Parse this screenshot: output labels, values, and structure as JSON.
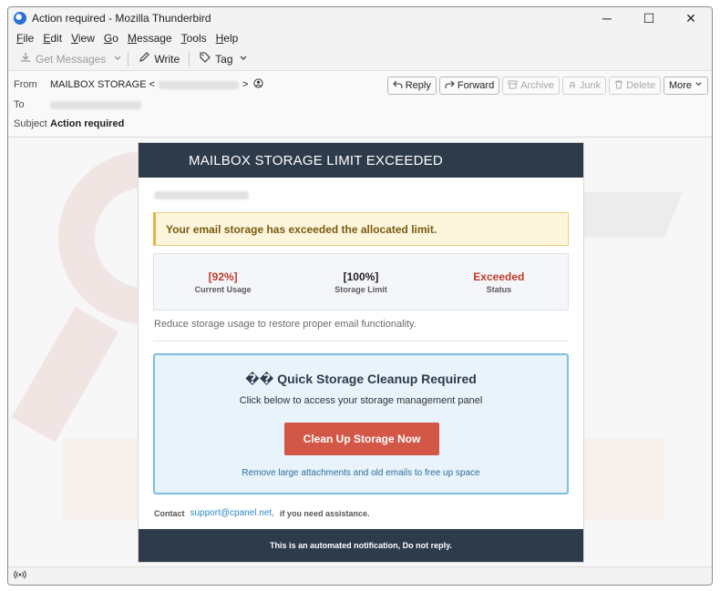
{
  "window": {
    "title": "Action required - Mozilla Thunderbird",
    "minimize": "─",
    "maximize": "☐",
    "close": "✕"
  },
  "menubar": {
    "items": [
      {
        "u": "F",
        "rest": "ile"
      },
      {
        "u": "E",
        "rest": "dit"
      },
      {
        "u": "V",
        "rest": "iew"
      },
      {
        "u": "G",
        "rest": "o"
      },
      {
        "u": "M",
        "rest": "essage"
      },
      {
        "u": "T",
        "rest": "ools"
      },
      {
        "u": "H",
        "rest": "elp"
      }
    ]
  },
  "toolbar": {
    "get_messages": "Get Messages",
    "write": "Write",
    "tag": "Tag"
  },
  "header": {
    "from_label": "From",
    "from_value": "MAILBOX STORAGE <",
    "from_close": ">",
    "to_label": "To",
    "subject_label": "Subject",
    "subject_value": "Action required",
    "actions": {
      "reply": "Reply",
      "forward": "Forward",
      "archive": "Archive",
      "junk": "Junk",
      "delete": "Delete",
      "more": "More"
    }
  },
  "email": {
    "header_title": "MAILBOX STORAGE LIMIT EXCEEDED",
    "alert": "Your email storage has exceeded the allocated limit.",
    "stats": [
      {
        "value": "[92%]",
        "label": "Current Usage",
        "color": "#c0392b"
      },
      {
        "value": "[100%]",
        "label": "Storage Limit",
        "color": "#1f1f1f"
      },
      {
        "value": "Exceeded",
        "label": "Status",
        "color": "#c0392b"
      }
    ],
    "reduce_text": "Reduce storage usage to restore proper email functionality.",
    "cleanup": {
      "title": "�� Quick Storage Cleanup Required",
      "subtitle": "Click below to access your storage management panel",
      "button": "Clean Up Storage Now",
      "note": "Remove large attachments and old emails to free up space"
    },
    "contact": {
      "label": "Contact",
      "email": "support@cpanel.net,",
      "suffix": "if you need assistance."
    },
    "footer": "This is an automated notification, Do not reply."
  },
  "colors": {
    "header_bg": "#2d3b4b",
    "alert_bg": "#fdf6dd",
    "alert_text": "#7a5a12",
    "button_bg": "#d35746",
    "cleanup_bg": "#e8f3fb",
    "cleanup_border": "#7fbbe2",
    "link": "#2d8ac5"
  },
  "icons": {
    "app": "thunderbird-icon",
    "get_messages": "download-icon",
    "write": "pencil-icon",
    "tag": "tag-icon",
    "reply": "reply-icon",
    "forward": "forward-icon",
    "archive": "archive-icon",
    "junk": "junk-icon",
    "delete": "trash-icon",
    "status": "wifi-signal-icon"
  }
}
